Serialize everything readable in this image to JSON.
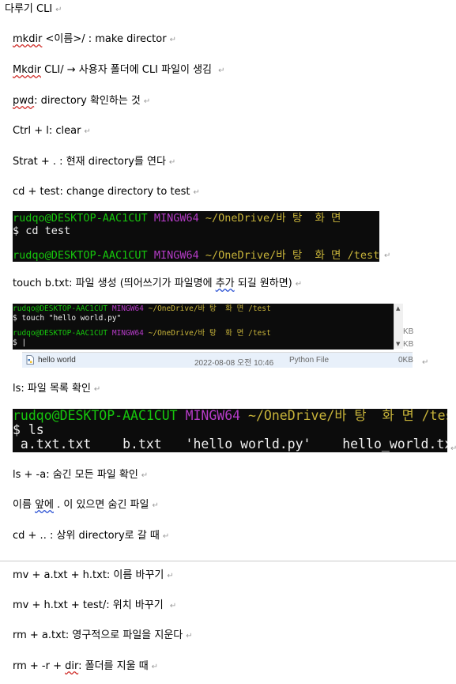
{
  "doc": {
    "title": "다루기 CLI",
    "paragraph_mark": "↵",
    "items": [
      {
        "pre": "",
        "mark": "mkdir",
        "post": " <이름>/ : make director"
      },
      {
        "pre": "",
        "mark": "Mkdir",
        "post": " CLI/ → 사용자 폴더에 CLI 파일이 생김 "
      },
      {
        "pre": "",
        "mark": "pwd",
        "post": ": directory 확인하는 것"
      },
      {
        "pre": "",
        "mark": "",
        "post": "Ctrl + l: clear"
      },
      {
        "pre": "",
        "mark": "",
        "post": "Strat + . : 현재 directory를 연다"
      },
      {
        "pre": "",
        "mark": "",
        "post": "cd + test: change directory to test"
      },
      {
        "pre": "touch b.txt: 파일 생성 (띄어쓰기가 파일명에 ",
        "mark": "추가",
        "post": " 되길 원하면)"
      },
      {
        "pre": "",
        "mark": "",
        "post": "ls: 파일 목록 확인"
      },
      {
        "pre": "",
        "mark": "",
        "post": "ls + -a: 숨긴 모든 파일 확인"
      },
      {
        "pre": "이름 ",
        "mark": "앞에",
        "post": " . 이 있으면 숨긴 파일"
      },
      {
        "pre": "",
        "mark": "",
        "post": "cd + .. : 상위 directory로 갈 때"
      },
      {
        "pre": "",
        "mark": "",
        "post": "mv + a.txt + h.txt: 이름 바꾸기"
      },
      {
        "pre": "",
        "mark": "",
        "post": "mv + h.txt + test/: 위치 바꾸기 "
      },
      {
        "pre": "",
        "mark": "",
        "post": "rm + a.txt: 영구적으로 파일을 지운다"
      },
      {
        "pre": "rm + -r + ",
        "mark": "dir",
        "post": ": 폴더를 지울 때"
      }
    ]
  },
  "term1": {
    "user": "rudqo@DESKTOP-AAC1CUT",
    "host": "MINGW64",
    "path1": "~/OneDrive/바 탕  화 면",
    "cmd": "$ cd test",
    "path2": "~/OneDrive/바 탕  화 면 /test"
  },
  "term2": {
    "user": "rudqo@DESKTOP-AAC1CUT",
    "host": "MINGW64",
    "path1": "~/OneDrive/바 탕  화 면 /test",
    "cmd": "$ touch \"hello world.py\"",
    "path2": "~/OneDrive/바 탕  화 면 /test",
    "prompt": "$ |",
    "kb1": "KB",
    "kb2": "KB",
    "file_name": "hello world",
    "file_date": "2022-08-08 오전 10:46",
    "file_type": "Python File",
    "file_size": "0KB"
  },
  "term3": {
    "user": "rudqo@DESKTOP-AAC1CUT",
    "host": "MINGW64",
    "path": "~/OneDrive/바 탕  화 면 /test",
    "cmd": "$ ls",
    "output": " a.txt.txt    b.txt   'hello world.py'    hello_world.txt"
  }
}
